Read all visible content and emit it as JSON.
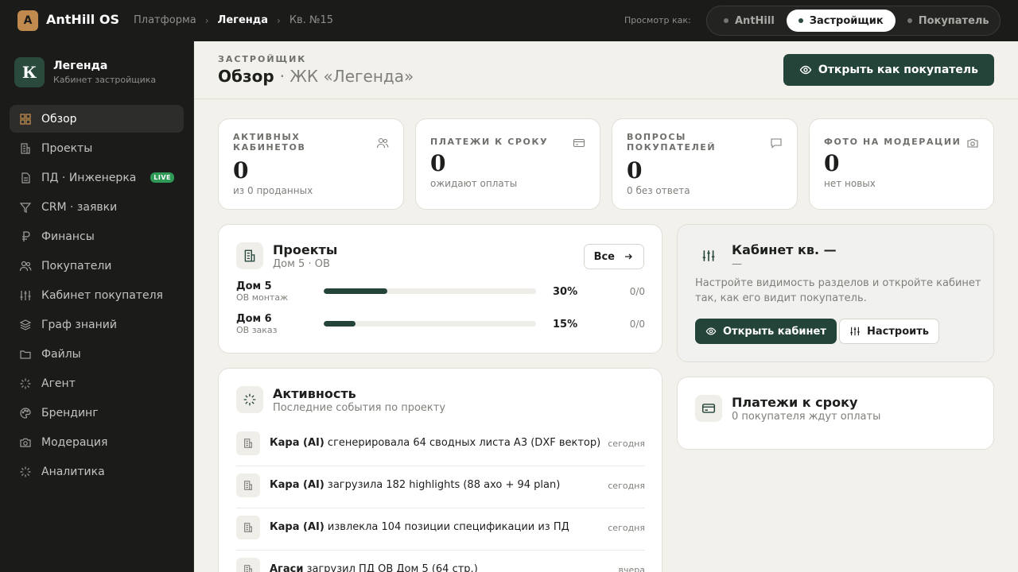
{
  "app": {
    "logo_letter": "A",
    "name": "AntHill OS"
  },
  "breadcrumbs": [
    "Платформа",
    "Легенда",
    "Кв. №15"
  ],
  "view_as": {
    "label": "Просмотр как:",
    "options": [
      "AntHill",
      "Застройщик",
      "Покупатель"
    ],
    "active": "Застройщик"
  },
  "org": {
    "badge": "К",
    "name": "Легенда",
    "subtitle": "Кабинет застройщика"
  },
  "sidebar": {
    "items": [
      {
        "label": "Обзор",
        "icon": "grid-icon",
        "active": true
      },
      {
        "label": "Проекты",
        "icon": "building-icon"
      },
      {
        "label": "ПД · Инженерка",
        "icon": "document-icon",
        "badge": "LIVE"
      },
      {
        "label": "CRM · заявки",
        "icon": "filter-icon"
      },
      {
        "label": "Финансы",
        "icon": "ruble-icon"
      },
      {
        "label": "Покупатели",
        "icon": "users-icon"
      },
      {
        "label": "Кабинет покупателя",
        "icon": "sliders-icon"
      },
      {
        "label": "Граф знаний",
        "icon": "layers-icon"
      },
      {
        "label": "Файлы",
        "icon": "folder-icon"
      },
      {
        "label": "Агент",
        "icon": "spark-icon"
      },
      {
        "label": "Брендинг",
        "icon": "palette-icon"
      },
      {
        "label": "Модерация",
        "icon": "camera-icon"
      },
      {
        "label": "Аналитика",
        "icon": "spark-icon"
      }
    ]
  },
  "header": {
    "eyebrow": "ЗАСТРОЙЩИК",
    "title": "Обзор",
    "subtitle": "· ЖК «Легенда»",
    "primary_button": "Открыть как покупатель"
  },
  "stats": [
    {
      "label": "АКТИВНЫХ КАБИНЕТОВ",
      "value": "0",
      "sub": "из 0 проданных",
      "icon": "users-icon"
    },
    {
      "label": "ПЛАТЕЖИ К СРОКУ",
      "value": "0",
      "sub": "ожидают оплаты",
      "icon": "card-icon"
    },
    {
      "label": "ВОПРОСЫ ПОКУПАТЕЛЕЙ",
      "value": "0",
      "sub": "0 без ответа",
      "icon": "chat-icon"
    },
    {
      "label": "ФОТО НА МОДЕРАЦИИ",
      "value": "0",
      "sub": "нет новых",
      "icon": "camera-icon"
    }
  ],
  "projects": {
    "title": "Проекты",
    "subtitle": "Дом 5 · ОВ",
    "all_button": "Все",
    "rows": [
      {
        "name": "Дом 5",
        "stage": "ОВ монтаж",
        "progress": 30,
        "progress_label": "30%",
        "ratio": "0/0"
      },
      {
        "name": "Дом 6",
        "stage": "ОВ заказ",
        "progress": 15,
        "progress_label": "15%",
        "ratio": "0/0"
      }
    ]
  },
  "activity": {
    "title": "Активность",
    "subtitle": "Последние события по проекту",
    "rows": [
      {
        "actor": "Кара (AI)",
        "text": " сгенерировала 64 сводных листа А3 (DXF вектор)",
        "time": "сегодня"
      },
      {
        "actor": "Кара (AI)",
        "text": " загрузила 182 highlights (88 axo + 94 plan)",
        "time": "сегодня"
      },
      {
        "actor": "Кара (AI)",
        "text": " извлекла 104 позиции спецификации из ПД",
        "time": "сегодня"
      },
      {
        "actor": "Агаси",
        "text": " загрузил ПД ОВ Дом 5 (64 стр.)",
        "time": "вчера"
      }
    ]
  },
  "cabinet": {
    "title": "Кабинет кв. —",
    "subtitle": "—",
    "description": "Настройте видимость разделов и откройте кабинет так, как его видит покупатель.",
    "open_button": "Открыть кабинет",
    "configure_button": "Настроить"
  },
  "payments": {
    "title": "Платежи к сроку",
    "subtitle": "0 покупателя ждут оплаты"
  }
}
